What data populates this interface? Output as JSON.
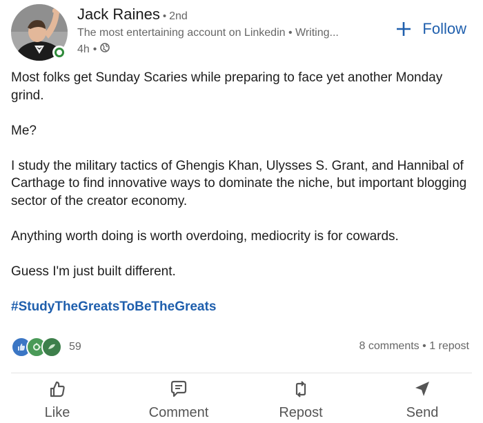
{
  "author": {
    "name": "Jack Raines",
    "separator": "•",
    "degree": "2nd",
    "headline": "The most entertaining account on Linkedin • Writing...",
    "time": "4h",
    "visibility_icon": "globe-icon"
  },
  "follow_button": {
    "icon": "plus-icon",
    "label": "Follow"
  },
  "post": {
    "paragraphs": [
      "Most folks get Sunday Scaries while preparing to face yet another Monday grind.",
      "Me?",
      "I study the military tactics of Ghengis Khan, Ulysses S. Grant, and Hannibal of Carthage to find innovative ways to dominate the niche, but important blogging sector of the creator economy.",
      "Anything worth doing is worth overdoing, mediocrity is for cowards.",
      "Guess I'm just built different."
    ],
    "hashtag": "#StudyTheGreatsToBeTheGreats"
  },
  "social": {
    "reaction_icons": [
      "like-icon",
      "celebrate-icon",
      "support-icon"
    ],
    "reaction_count": "59",
    "comments": "8 comments",
    "separator": "•",
    "reposts": "1 repost"
  },
  "actions": [
    {
      "label": "Like",
      "icon": "thumbs-up-icon"
    },
    {
      "label": "Comment",
      "icon": "comment-icon"
    },
    {
      "label": "Repost",
      "icon": "repost-icon"
    },
    {
      "label": "Send",
      "icon": "send-icon"
    }
  ],
  "colors": {
    "accent": "#1f5fad",
    "text": "#1d1d1d",
    "muted": "#666666",
    "online": "#2f8a3a"
  }
}
